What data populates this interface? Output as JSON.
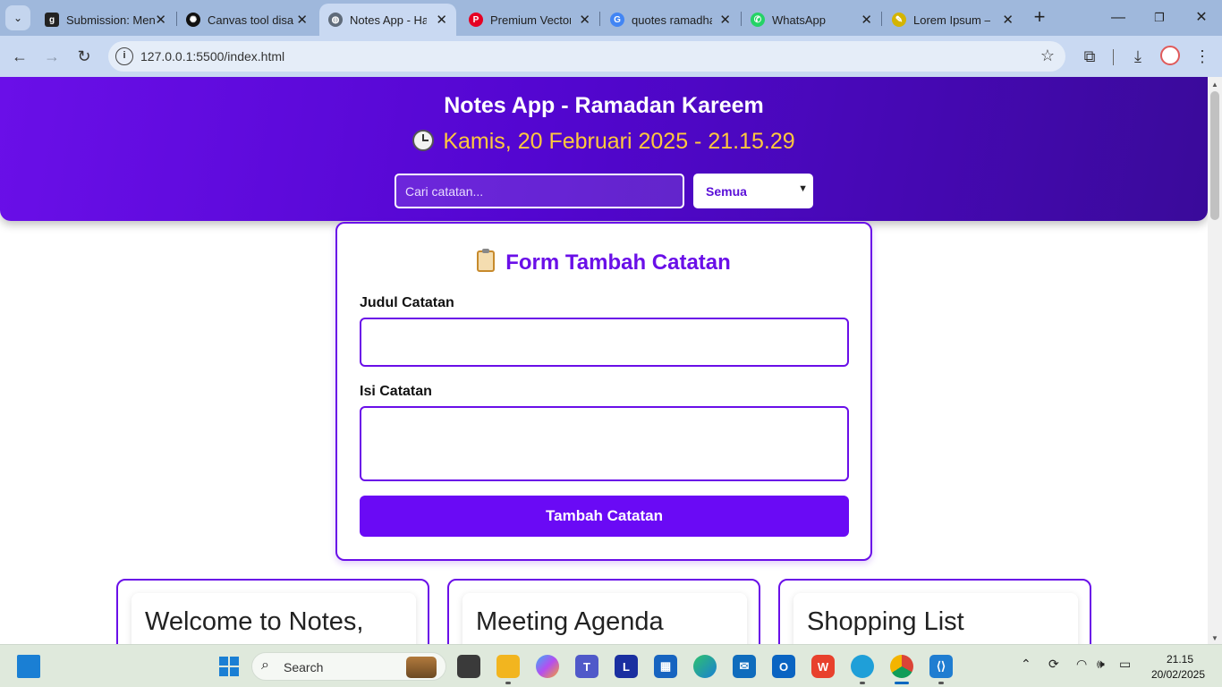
{
  "browser": {
    "tabs": [
      {
        "title": "Submission: Men",
        "favicon": "dicoding-icon",
        "favicon_color": "#222222",
        "active": false
      },
      {
        "title": "Canvas tool disa",
        "favicon": "openai-icon",
        "favicon_color": "#111111",
        "active": false
      },
      {
        "title": "Notes App - Har",
        "favicon": "globe-icon",
        "favicon_color": "#5f6b7a",
        "active": true
      },
      {
        "title": "Premium Vector",
        "favicon": "pinterest-icon",
        "favicon_color": "#e60023",
        "active": false
      },
      {
        "title": "quotes ramadha",
        "favicon": "google-icon",
        "favicon_color": "#4285f4",
        "active": false
      },
      {
        "title": "WhatsApp",
        "favicon": "whatsapp-icon",
        "favicon_color": "#25d366",
        "active": false
      },
      {
        "title": "Lorem Ipsum – (",
        "favicon": "lorem-icon",
        "favicon_color": "#d4b400",
        "active": false
      }
    ],
    "url": "127.0.0.1:5500/index.html"
  },
  "header": {
    "title": "Notes App - Ramadan Kareem",
    "datetime": "Kamis, 20 Februari 2025 - 21.15.29",
    "search_placeholder": "Cari catatan...",
    "filter_selected": "Semua",
    "accent_color": "#6a0fe8",
    "clock_color": "#ffc83d"
  },
  "form": {
    "heading": "Form Tambah Catatan",
    "title_label": "Judul Catatan",
    "title_value": "",
    "body_label": "Isi Catatan",
    "body_value": "",
    "submit_label": "Tambah Catatan"
  },
  "notes": [
    {
      "title": "Welcome to Notes,"
    },
    {
      "title": "Meeting Agenda"
    },
    {
      "title": "Shopping List"
    }
  ],
  "taskbar": {
    "search_text": "Search",
    "time": "21.15",
    "date": "20/02/2025"
  }
}
